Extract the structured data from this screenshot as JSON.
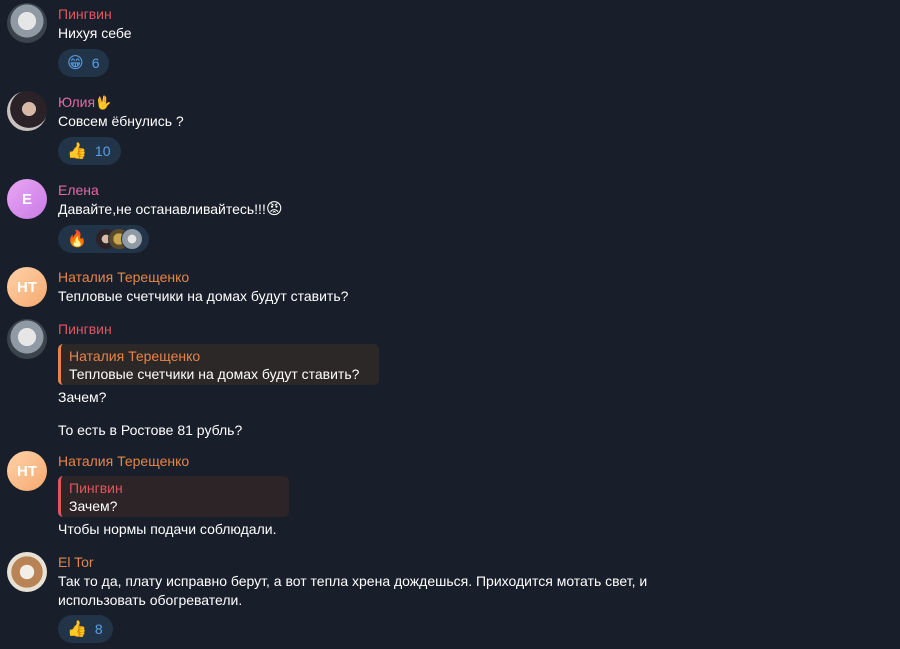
{
  "colors": {
    "background": "#181f2a",
    "name_penguin": "#e0555f",
    "name_pink": "#e46aa6",
    "name_orange": "#e8844a",
    "reaction_bg": "#223448",
    "reaction_count": "#5aa0e6"
  },
  "messages": [
    {
      "author": "Пингвин",
      "avatar_icon": "penguin-avatar",
      "text": "Нихуя себе",
      "reaction": {
        "emoji": "😁",
        "count": "6"
      }
    },
    {
      "author": "Юлия",
      "author_emoji": "🖖",
      "avatar_icon": "photo-avatar",
      "text": "Совсем ёбнулись ?",
      "reaction": {
        "emoji": "👍",
        "count": "10"
      }
    },
    {
      "author": "Елена",
      "avatar_initials": "Е",
      "text": "Давайте,не останавливайтесь!!!",
      "text_emoji": "😡",
      "reaction": {
        "emoji": "🔥"
      }
    },
    {
      "author": "Наталия Терещенко",
      "avatar_initials": "НТ",
      "text": "Тепловые счетчики на домах будут ставить?"
    },
    {
      "author": "Пингвин",
      "avatar_icon": "penguin-avatar",
      "reply": {
        "author": "Наталия Терещенко",
        "text": "Тепловые счетчики на домах будут ставить?"
      },
      "text": "Зачем?",
      "text2": "То есть в Ростове 81 рубль?"
    },
    {
      "author": "Наталия Терещенко",
      "avatar_initials": "НТ",
      "reply": {
        "author": "Пингвин",
        "text": "Зачем?"
      },
      "text": "Чтобы нормы подачи соблюдали."
    },
    {
      "author": "El Tor",
      "avatar_icon": "dog-avatar",
      "text_line1": "Так то да, плату исправно берут, а вот тепла хрена дождешься. Приходится мотать свет, и",
      "text_line2": "использовать обогреватели.",
      "reaction": {
        "emoji": "👍",
        "count": "8"
      }
    }
  ]
}
